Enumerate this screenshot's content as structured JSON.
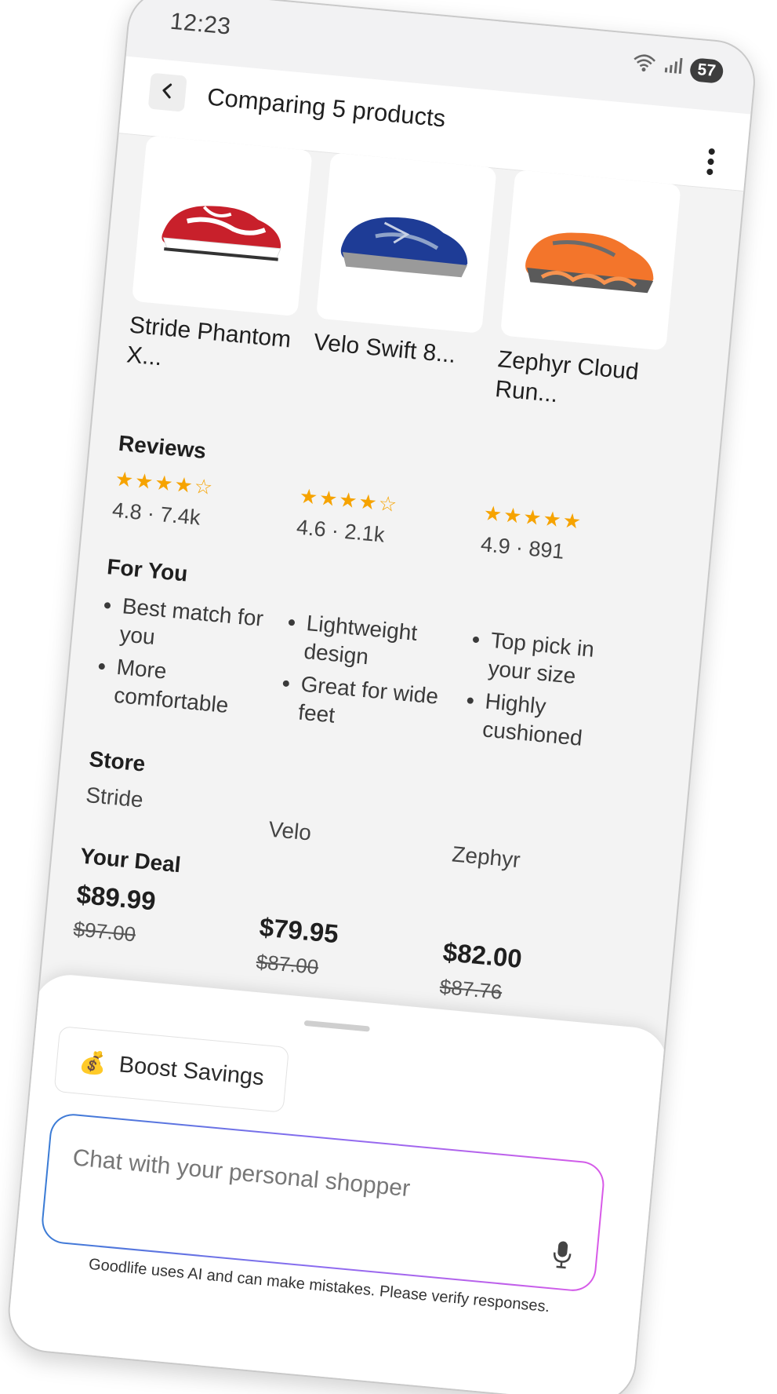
{
  "status_bar": {
    "time": "12:23",
    "battery": "57",
    "wifi_icon": "wifi-icon",
    "signal_icon": "signal-icon"
  },
  "header": {
    "title": "Comparing 5 products",
    "back_icon": "chevron-left-icon",
    "menu_icon": "more-vertical-icon"
  },
  "sections": {
    "reviews": "Reviews",
    "for_you": "For You",
    "store": "Store",
    "your_deal": "Your Deal"
  },
  "products": [
    {
      "name": "Stride Phantom X...",
      "image_icon": "red-running-shoe",
      "stars": "★★★★☆",
      "rating": "4.8 · 7.4k",
      "for_you": [
        "Best match for you",
        "More comfortable"
      ],
      "store": "Stride",
      "price": "$89.99",
      "old_price": "$97.00"
    },
    {
      "name": "Velo Swift 8...",
      "image_icon": "blue-running-shoe",
      "stars": "★★★★☆",
      "rating": "4.6 · 2.1k",
      "for_you": [
        "Lightweight design",
        "Great for wide feet"
      ],
      "store": "Velo",
      "price": "$79.95",
      "old_price": "$87.00"
    },
    {
      "name": "Zephyr Cloud Run...",
      "image_icon": "orange-running-shoe",
      "stars": "★★★★★",
      "rating": "4.9 · 891",
      "for_you": [
        "Top pick in your size",
        "Highly cushioned"
      ],
      "store": "Zephyr",
      "price": "$82.00",
      "old_price": "$87.76"
    }
  ],
  "sheet": {
    "boost_emoji": "💰",
    "boost_label": "Boost Savings",
    "chat_placeholder": "Chat with your personal shopper",
    "mic_icon": "microphone-icon",
    "disclaimer": "Goodlife uses AI and can make mistakes. Please verify responses."
  },
  "colors": {
    "star": "#f6a300",
    "gradient_start": "#3a7bd5",
    "gradient_end": "#d85ae8",
    "screen_bg": "#f3f3f3"
  }
}
